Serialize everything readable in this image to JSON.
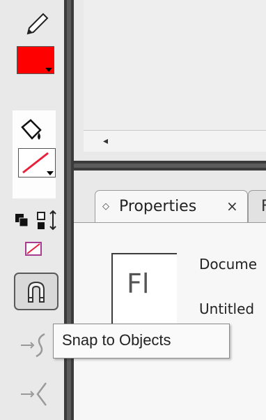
{
  "tools_panel": {
    "stroke_color": "#ff0000",
    "fill_color": "#ffffff",
    "icons": [
      "pencil-icon",
      "paint-bucket-icon",
      "black-white-icon",
      "swap-colors-icon",
      "no-color-icon",
      "magnet-icon",
      "smooth-icon",
      "straighten-icon"
    ]
  },
  "stage": {
    "scroll_left_glyph": "◂"
  },
  "properties_panel": {
    "tab_icon": "◇",
    "tab_label": "Properties",
    "tab_close": "×",
    "next_tab_label": "F",
    "logo_text": "Fl",
    "document_label": "Docume",
    "document_name": "Untitled"
  },
  "tooltip": {
    "text": "Snap to Objects"
  }
}
